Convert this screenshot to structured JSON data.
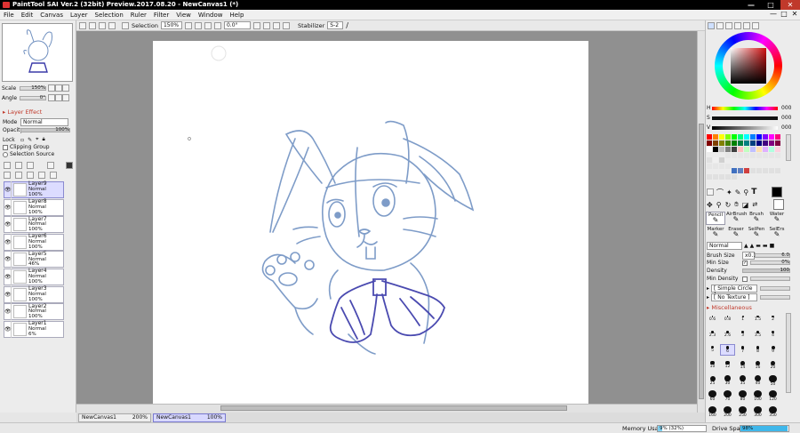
{
  "window": {
    "title": "PaintTool SAI Ver.2 (32bit) Preview.2017.08.20 - NewCanvas1 (*)",
    "min": "—",
    "max": "□",
    "close": "✕"
  },
  "menu": [
    "File",
    "Edit",
    "Canvas",
    "Layer",
    "Selection",
    "Ruler",
    "Filter",
    "View",
    "Window",
    "Help"
  ],
  "toolbar": {
    "selection_label": "Selection",
    "zoom": "150%",
    "angle": "0.0°",
    "stabilizer_label": "Stabilizer",
    "stabilizer_value": "S-2"
  },
  "navigator": {
    "scale_label": "Scale",
    "scale_value": "150%",
    "angle_label": "Angle",
    "angle_value": "0°"
  },
  "layer_effect": {
    "title": "Layer Effect",
    "mode_label": "Mode",
    "mode_value": "Normal",
    "opacity_label": "Opacity",
    "opacity_value": "100%",
    "lock_label": "Lock",
    "clipping_label": "Clipping Group",
    "selection_source_label": "Selection Source"
  },
  "layers": [
    {
      "name": "Layer9",
      "mode": "Normal",
      "opacity": "100%",
      "selected": true
    },
    {
      "name": "Layer8",
      "mode": "Normal",
      "opacity": "100%"
    },
    {
      "name": "Layer7",
      "mode": "Normal",
      "opacity": "100%"
    },
    {
      "name": "Layer6",
      "mode": "Normal",
      "opacity": "100%"
    },
    {
      "name": "Layer5",
      "mode": "Normal",
      "opacity": "46%"
    },
    {
      "name": "Layer4",
      "mode": "Normal",
      "opacity": "100%"
    },
    {
      "name": "Layer3",
      "mode": "Normal",
      "opacity": "100%"
    },
    {
      "name": "Layer2",
      "mode": "Normal",
      "opacity": "100%"
    },
    {
      "name": "Layer1",
      "mode": "Normal",
      "opacity": "6%"
    }
  ],
  "tabs": [
    {
      "name": "NewCanvas1",
      "zoom": "200%"
    },
    {
      "name": "NewCanvas1",
      "zoom": "100%",
      "active": true
    }
  ],
  "status": {
    "memory_label": "Memory Usage",
    "memory_value": "9% (32%)",
    "memory_fraction": 0.09,
    "drive_label": "Drive Space",
    "drive_value": "98%",
    "drive_fraction": 0.98
  },
  "color": {
    "current_hex": "#8b1a1a",
    "h_label": "H",
    "h_value": "000",
    "s_label": "S",
    "s_value": "000",
    "v_label": "V",
    "v_value": "000",
    "fg_hex": "#000000",
    "bg_hex": "#ffffff"
  },
  "tools": {
    "names": [
      "Pencil",
      "AirBrush",
      "Brush",
      "Water",
      "Marker",
      "Eraser",
      "SelPen",
      "SelErs"
    ]
  },
  "brush": {
    "mode_value": "Normal",
    "size_label": "Brush Size",
    "size_mult": "x0.1",
    "size_value": "6.0",
    "min_size_label": "Min Size",
    "min_size_value": "0%",
    "density_label": "Density",
    "density_value": "100",
    "min_density_label": "Min Density",
    "shape_value": "[ Simple Circle ]",
    "texture_value": "[ No Texture ]",
    "misc_title": "Miscellaneous"
  },
  "brush_sizes": [
    "0.6",
    "0.8",
    "1",
    "1.5",
    "2",
    "2.3",
    "2.6",
    "3",
    "3.5",
    "4",
    "5",
    "6",
    "7",
    "8",
    "9",
    "10",
    "12",
    "14",
    "16",
    "20",
    "25",
    "30",
    "35",
    "40",
    "50",
    "60",
    "70",
    "80",
    "100",
    "120",
    "160",
    "200",
    "250",
    "300",
    "350"
  ]
}
